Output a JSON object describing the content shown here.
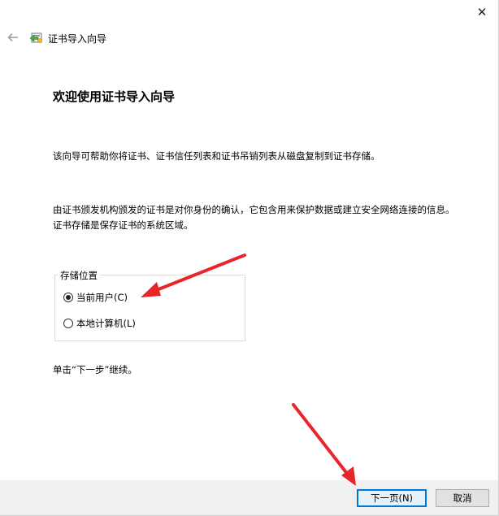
{
  "titlebar": {
    "close_glyph": "✕"
  },
  "header": {
    "title": "证书导入向导",
    "back_icon": "back-arrow-icon",
    "wizard_icon": "certificate-wizard-icon"
  },
  "main": {
    "heading": "欢迎使用证书导入向导",
    "intro": "该向导可帮助你将证书、证书信任列表和证书吊销列表从磁盘复制到证书存储。",
    "description": "由证书颁发机构颁发的证书是对你身份的确认，它包含用来保护数据或建立安全网络连接的信息。证书存储是保存证书的系统区域。",
    "store_location": {
      "label": "存储位置",
      "options": [
        {
          "label": "当前用户(C)",
          "checked": true
        },
        {
          "label": "本地计算机(L)",
          "checked": false
        }
      ]
    },
    "continue_hint": "单击“下一步”继续。"
  },
  "footer": {
    "next_label": "下一页(N)",
    "cancel_label": "取消"
  },
  "annotations": {
    "arrow_color": "#e8262a"
  }
}
